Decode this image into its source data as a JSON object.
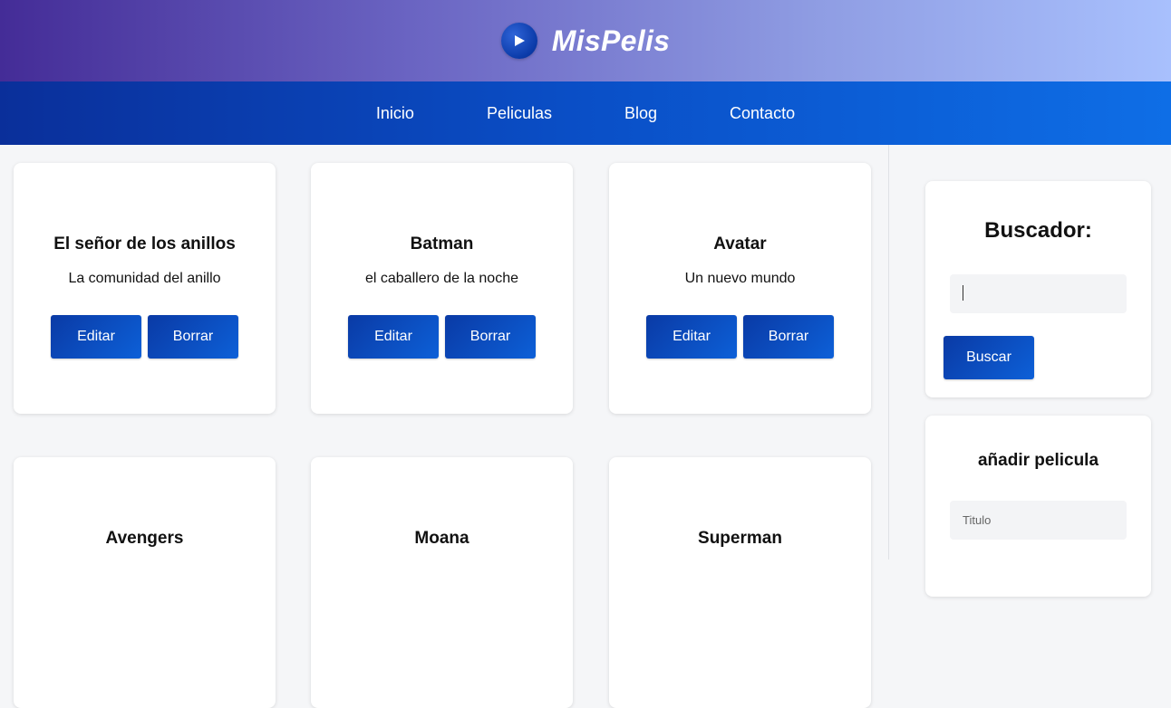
{
  "brand": {
    "name": "MisPelis",
    "icon": "play-icon"
  },
  "nav": [
    "Inicio",
    "Peliculas",
    "Blog",
    "Contacto"
  ],
  "movies": [
    {
      "title": "El señor de los anillos",
      "subtitle": "La comunidad del anillo"
    },
    {
      "title": "Batman",
      "subtitle": "el caballero de la noche"
    },
    {
      "title": "Avatar",
      "subtitle": "Un nuevo mundo"
    },
    {
      "title": "Avengers",
      "subtitle": ""
    },
    {
      "title": "Moana",
      "subtitle": ""
    },
    {
      "title": "Superman",
      "subtitle": ""
    }
  ],
  "card_actions": {
    "edit": "Editar",
    "delete": "Borrar"
  },
  "search": {
    "title": "Buscador:",
    "value": "",
    "button": "Buscar"
  },
  "add": {
    "title": "añadir pelicula",
    "title_placeholder": "Titulo"
  },
  "colors": {
    "nav_start": "#0a2f9a",
    "nav_end": "#0e6ee6",
    "header_start": "#442c97",
    "header_end": "#a8c0fd",
    "button": "#0d4fc8"
  }
}
